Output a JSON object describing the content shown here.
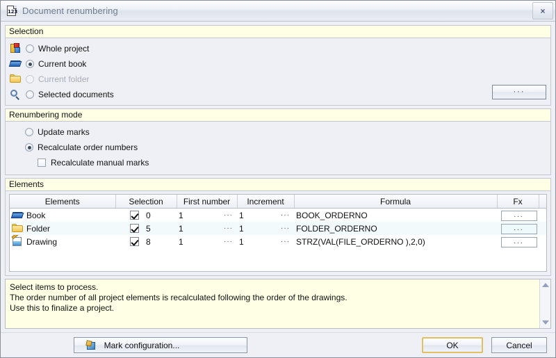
{
  "window": {
    "title": "Document renumbering",
    "icon": "document-123-icon",
    "close_label": "×"
  },
  "selection": {
    "header": "Selection",
    "options": [
      {
        "label": "Whole project",
        "icon": "project-icon",
        "checked": false,
        "disabled": false
      },
      {
        "label": "Current book",
        "icon": "book-icon",
        "checked": true,
        "disabled": false
      },
      {
        "label": "Current folder",
        "icon": "folder-icon",
        "checked": false,
        "disabled": true
      },
      {
        "label": "Selected documents",
        "icon": "search-icon",
        "checked": false,
        "disabled": false
      }
    ],
    "browse_label": "..."
  },
  "renumbering_mode": {
    "header": "Renumbering mode",
    "options": [
      {
        "label": "Update marks",
        "checked": false
      },
      {
        "label": "Recalculate order numbers",
        "checked": true
      }
    ],
    "sub_checkbox": {
      "label": "Recalculate manual marks",
      "checked": false
    }
  },
  "elements": {
    "header": "Elements",
    "columns": [
      "Elements",
      "Selection",
      "First number",
      "Increment",
      "Formula",
      "Fx"
    ],
    "rows": [
      {
        "name": "Book",
        "icon": "book-icon",
        "selected": true,
        "selection_value": "0",
        "first_number": "1",
        "increment": "1",
        "formula": "BOOK_ORDERNO",
        "fx_label": "..."
      },
      {
        "name": "Folder",
        "icon": "folder-icon",
        "selected": true,
        "selection_value": "5",
        "first_number": "1",
        "increment": "1",
        "formula": "FOLDER_ORDERNO",
        "fx_label": "..."
      },
      {
        "name": "Drawing",
        "icon": "drawing-icon",
        "selected": true,
        "selection_value": "8",
        "first_number": "1",
        "increment": "1",
        "formula": "STRZ(VAL(FILE_ORDERNO ),2,0)",
        "fx_label": "..."
      }
    ],
    "ellipsis": "···"
  },
  "description": {
    "lines": [
      "Select items to process.",
      "The order number of all project elements is recalculated following the order of the drawings.",
      "Use this to finalize a project."
    ]
  },
  "footer": {
    "mark_configuration_label": "Mark configuration...",
    "ok_label": "OK",
    "cancel_label": "Cancel"
  },
  "colors": {
    "group_header_bg": "#feffe4",
    "dialog_bg": "#eef0f5",
    "row_alt_bg": "#f2fafc",
    "focus_border": "#e0c060",
    "title_text": "#6f7e92"
  }
}
